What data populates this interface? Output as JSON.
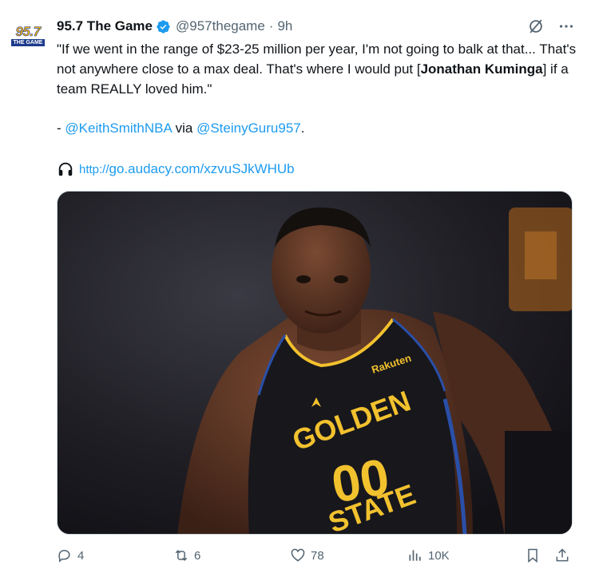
{
  "account": {
    "avatar_num": "95.7",
    "avatar_sub": "THE GAME",
    "name": "95.7 The Game",
    "handle": "@957thegame",
    "separator": "·",
    "time": "9h"
  },
  "tweet": {
    "quote_part1": "\"If we went in the range of $23-25 million per year, I'm not going to balk at that... That's not anywhere close to a max deal. That's where I would put [",
    "quote_bold": "Jonathan Kuminga",
    "quote_part2": "] if a team REALLY loved him.\"",
    "credit_prefix": "- ",
    "credit_mention1": "@KeithSmithNBA",
    "credit_via": " via ",
    "credit_mention2": "@SteinyGuru957",
    "credit_end": ".",
    "url_protocol": "http://",
    "url_rest": "go.audacy.com/xzvuSJkWHUb",
    "jersey_sponsor": "Rakuten",
    "jersey_line1": "GOLDEN",
    "jersey_line2": "STATE",
    "jersey_number": "00"
  },
  "actions": {
    "replies": "4",
    "reposts": "6",
    "likes": "78",
    "views": "10K"
  },
  "colors": {
    "link": "#1d9bf0",
    "muted": "#536471",
    "verified": "#1d9bf0",
    "jersey_gold": "#f2c12e"
  }
}
